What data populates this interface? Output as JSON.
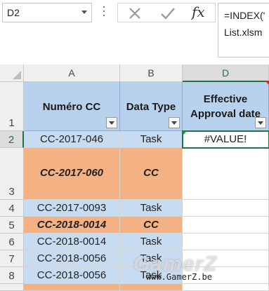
{
  "name_box": {
    "value": "D2"
  },
  "formula_bar": {
    "cancel_icon": "x-icon",
    "enter_icon": "check-icon",
    "fx_label": "fx",
    "formula_line1": "=INDEX('",
    "formula_line2": "List.xlsm"
  },
  "columns": [
    {
      "letter": "A"
    },
    {
      "letter": "B"
    },
    {
      "letter": "D"
    }
  ],
  "header_row": {
    "row_num": "1",
    "col_a": "Numéro CC",
    "col_b": "Data Type",
    "col_d_line1": "Effective",
    "col_d_line2": "Approval date"
  },
  "rows": [
    {
      "num": "2",
      "a": "CC-2017-046",
      "b": "Task",
      "d": "#VALUE!"
    },
    {
      "num": "3",
      "a": "CC-2017-060",
      "b": "CC",
      "d": ""
    },
    {
      "num": "4",
      "a": "CC-2017-0093",
      "b": "Task",
      "d": ""
    },
    {
      "num": "5",
      "a": "CC-2018-0014",
      "b": "CC",
      "d": ""
    },
    {
      "num": "6",
      "a": "CC-2018-0014",
      "b": "Task",
      "d": ""
    },
    {
      "num": "7",
      "a": "CC-2018-0056",
      "b": "Task",
      "d": ""
    },
    {
      "num": "8",
      "a": "CC-2018-0056",
      "b": "Task",
      "d": ""
    }
  ],
  "watermark": {
    "brand": "GamerZ",
    "url": "www.GamerZ.be"
  },
  "colors": {
    "header_blue": "#b8d2ee",
    "row_blue": "#c7dbf1",
    "row_orange": "#f4b183",
    "selection_green": "#217346"
  }
}
